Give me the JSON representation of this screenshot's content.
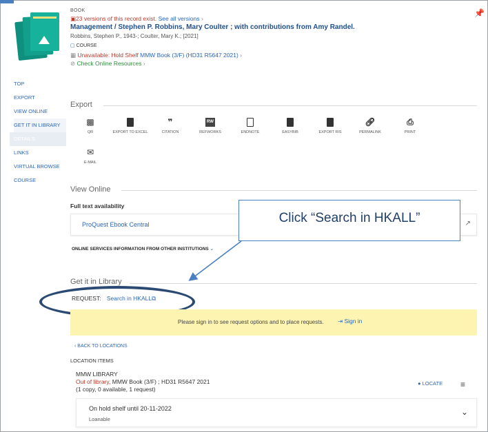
{
  "record": {
    "type": "BOOK",
    "versions_text": "23 versions of this record exist.",
    "versions_link": "See all versions",
    "title": "Management / Stephen P. Robbins, Mary Coulter ; with contributions from Amy Randel.",
    "authors": "Robbins, Stephen P., 1943-; Coulter, Mary K.; [2021]",
    "course_badge": "COURSE",
    "availability_status": "Unavailable: Hold Shelf",
    "availability_location": "MMW Book (3/F) (HD31 R5647 2021)",
    "check_online": "Check Online Resources"
  },
  "nav": {
    "items": [
      {
        "label": "TOP"
      },
      {
        "label": "EXPORT"
      },
      {
        "label": "VIEW ONLINE"
      },
      {
        "label": "GET IT IN LIBRARY"
      },
      {
        "label": "DETAILS"
      },
      {
        "label": "LINKS"
      },
      {
        "label": "VIRTUAL BROWSE"
      },
      {
        "label": "COURSE"
      }
    ]
  },
  "export": {
    "title": "Export",
    "items": [
      {
        "label": "QR",
        "icon": "qr-icon"
      },
      {
        "label": "EXPORT TO EXCEL",
        "icon": "excel-icon"
      },
      {
        "label": "CITATION",
        "icon": "quote-icon"
      },
      {
        "label": "REFWORKS",
        "icon": "refworks-icon",
        "icon_text": "RW"
      },
      {
        "label": "ENDNOTE",
        "icon": "document-icon"
      },
      {
        "label": "EASYBIB",
        "icon": "document-filled-icon"
      },
      {
        "label": "EXPORT RIS",
        "icon": "document-filled-icon"
      },
      {
        "label": "PERMALINK",
        "icon": "link-icon"
      },
      {
        "label": "PRINT",
        "icon": "printer-icon"
      },
      {
        "label": "E-MAIL",
        "icon": "envelope-icon"
      }
    ]
  },
  "view_online": {
    "title": "View Online",
    "full_text_label": "Full text availability",
    "provider": "ProQuest Ebook Central",
    "other_institutions": "ONLINE SERVICES INFORMATION FROM OTHER INSTITUTIONS"
  },
  "get_it": {
    "title": "Get it in Library",
    "request_label": "REQUEST:",
    "request_link": "Search in HKALL",
    "signin_message": "Please sign in to see request options and to place requests.",
    "signin_link": "Sign in",
    "back_link": "BACK TO LOCATIONS",
    "location_items_label": "LOCATION ITEMS",
    "library_name": "MMW LIBRARY",
    "library_status": "Out of library",
    "library_location": ", MMW Book (3/F) ; HD31 R5647 2021",
    "library_copies": "(1 copy, 0 available, 1 request)",
    "locate_label": "LOCATE",
    "item_status": "On hold shelf until 20-11-2022",
    "item_policy": "Loanable"
  },
  "annotation": {
    "callout_text": "Click “Search in HKALL”",
    "color": "#2b4a73"
  }
}
